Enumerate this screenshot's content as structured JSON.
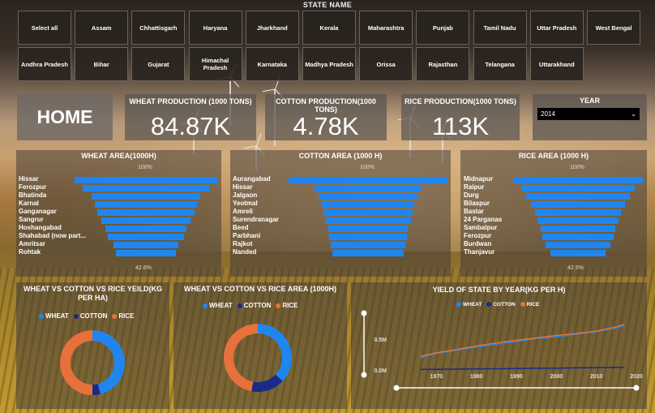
{
  "slicer": {
    "title": "STATE NAME",
    "row1": [
      "Select all",
      "Assam",
      "Chhattisgarh",
      "Haryana",
      "Jharkhand",
      "Kerala",
      "Maharashtra",
      "Punjab",
      "Tamil Nadu",
      "Uttar Pradesh",
      "West Bengal"
    ],
    "row2": [
      "Andhra Pradesh",
      "Bihar",
      "Gujarat",
      "Himachal Pradesh",
      "Karnataka",
      "Madhya Pradesh",
      "Orissa",
      "Rajasthan",
      "Telangana",
      "Uttarakhand"
    ]
  },
  "home": {
    "label": "HOME"
  },
  "kpis": {
    "wheat": {
      "label": "WHEAT PRODUCTION (1000 TONS)",
      "value": "84.87K"
    },
    "cotton": {
      "label": "COTTON PRODUCTION(1000 TONS)",
      "value": "4.78K"
    },
    "rice": {
      "label": "RICE PRODUCTION(1000 TONS)",
      "value": "113K"
    }
  },
  "year": {
    "label": "YEAR",
    "value": "2014"
  },
  "colors": {
    "wheat": "#1f86f0",
    "cotton": "#1a2a8a",
    "rice": "#e8703a",
    "funnel": "#1f86f0"
  },
  "funnels": {
    "wheat": {
      "title": "WHEAT AREA(1000H)",
      "top_pct": "100%",
      "bottom_pct": "42.6%",
      "labels": [
        "Hissar",
        "Ferozpur",
        "Bhatinda",
        "Karnal",
        "Ganganagar",
        "Sangrur",
        "Hoshangabad",
        "Shahabad (now part...",
        "Amritsar",
        "Rohtak"
      ],
      "values": [
        100,
        89,
        76,
        72,
        68,
        63,
        57,
        53,
        46,
        42.6
      ]
    },
    "cotton": {
      "title": "COTTON AREA (1000 H)",
      "top_pct": "100%",
      "labels": [
        "Aurangabad",
        "Hissar",
        "Jalgaon",
        "Yeotmal",
        "Amreli",
        "Surendranagar",
        "Beed",
        "Parbhani",
        "Rajkot",
        "Nanded"
      ],
      "values": [
        100,
        67,
        62,
        58,
        56,
        54,
        50,
        49,
        47,
        45
      ]
    },
    "rice": {
      "title": "RICE AREA (1000 H)",
      "top_pct": "100%",
      "bottom_pct": "42.5%",
      "labels": [
        "Midnapur",
        "Raipur",
        "Durg",
        "Bilaspur",
        "Bastar",
        "24 Parganas",
        "Sambalpur",
        "Ferozpur",
        "Burdwan",
        "Thanjavur"
      ],
      "values": [
        100,
        88,
        80,
        72,
        66,
        63,
        58,
        55,
        50,
        42.5
      ]
    }
  },
  "chart_data": [
    {
      "type": "pie",
      "title": "WHEAT VS COTTON VS RICE YEILD(KG PER HA)",
      "legend": [
        "WHEAT",
        "COTTON",
        "RICE"
      ],
      "values": [
        46,
        4,
        50
      ]
    },
    {
      "type": "pie",
      "title": "WHEAT VS COTTON VS RICE AREA (1000H)",
      "legend": [
        "WHEAT",
        "COTTON",
        "RICE"
      ],
      "values": [
        37,
        16,
        47
      ]
    },
    {
      "type": "line",
      "title": "YIELD OF STATE BY YEAR(KG PER H)",
      "legend": [
        "WHEAT",
        "COTTON",
        "RICE"
      ],
      "x": [
        1966,
        1970,
        1975,
        1980,
        1985,
        1990,
        1995,
        2000,
        2005,
        2010,
        2015,
        2017
      ],
      "xticks": [
        "1970",
        "1980",
        "1990",
        "2000",
        "2010",
        "2020"
      ],
      "yticks": [
        "0.5M",
        "0.0M"
      ],
      "ylim": [
        0,
        1000000
      ],
      "series": [
        {
          "name": "WHEAT",
          "values": [
            200000,
            270000,
            320000,
            370000,
            420000,
            460000,
            510000,
            540000,
            580000,
            620000,
            680000,
            720000
          ]
        },
        {
          "name": "COTTON",
          "values": [
            10000,
            12000,
            15000,
            18000,
            20000,
            24000,
            28000,
            30000,
            35000,
            40000,
            42000,
            44000
          ]
        },
        {
          "name": "RICE",
          "values": [
            220000,
            280000,
            330000,
            390000,
            440000,
            480000,
            520000,
            560000,
            590000,
            630000,
            700000,
            740000
          ]
        }
      ]
    }
  ]
}
